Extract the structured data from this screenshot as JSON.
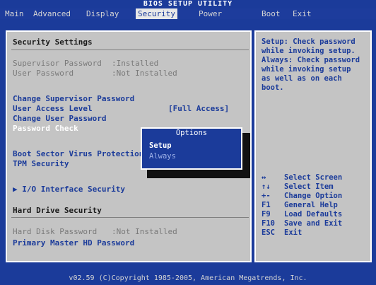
{
  "title": "BIOS SETUP UTILITY",
  "menu": [
    "Main",
    "Advanced",
    "Display",
    "Security",
    "Power",
    "Boot",
    "Exit"
  ],
  "active_menu": "Security",
  "left": {
    "security_header": "Security Settings",
    "supervisor_label": "Supervisor Password",
    "supervisor_value": ":Installed",
    "user_label": "User Password",
    "user_value": ":Not Installed",
    "change_supervisor": "Change Supervisor Password",
    "user_access_label": "User Access Level",
    "user_access_value": "[Full Access]",
    "change_user": "Change User Password",
    "password_check": "Password Check",
    "boot_sector": "Boot Sector Virus Protection",
    "tpm": "TPM Security",
    "io_interface": "▶ I/O Interface Security",
    "hdd_header": "Hard Drive Security",
    "hdd_label": "Hard Disk Password",
    "hdd_value": ":Not Installed",
    "primary_master": "Primary Master HD Password"
  },
  "options": {
    "title": "Options",
    "items": [
      "Setup",
      "Always"
    ],
    "selected": "Setup"
  },
  "help": {
    "text": "Setup: Check password\nwhile invoking setup.\nAlways: Check password\nwhile invoking setup\nas well as on each\nboot."
  },
  "keys": [
    {
      "glyph": "↔",
      "desc": "Select Screen"
    },
    {
      "glyph": "↑↓",
      "desc": "Select Item"
    },
    {
      "glyph": "+-",
      "desc": "Change Option"
    },
    {
      "glyph": "F1",
      "desc": "General Help"
    },
    {
      "glyph": "F9",
      "desc": "Load Defaults"
    },
    {
      "glyph": "F10",
      "desc": "Save and Exit"
    },
    {
      "glyph": "ESC",
      "desc": "Exit"
    }
  ],
  "footer": "v02.59 (C)Copyright 1985-2005, American Megatrends, Inc.",
  "colors": {
    "background": "#1b3b9a",
    "panel": "#c4c4c4",
    "highlight_text": "#ffffff"
  }
}
